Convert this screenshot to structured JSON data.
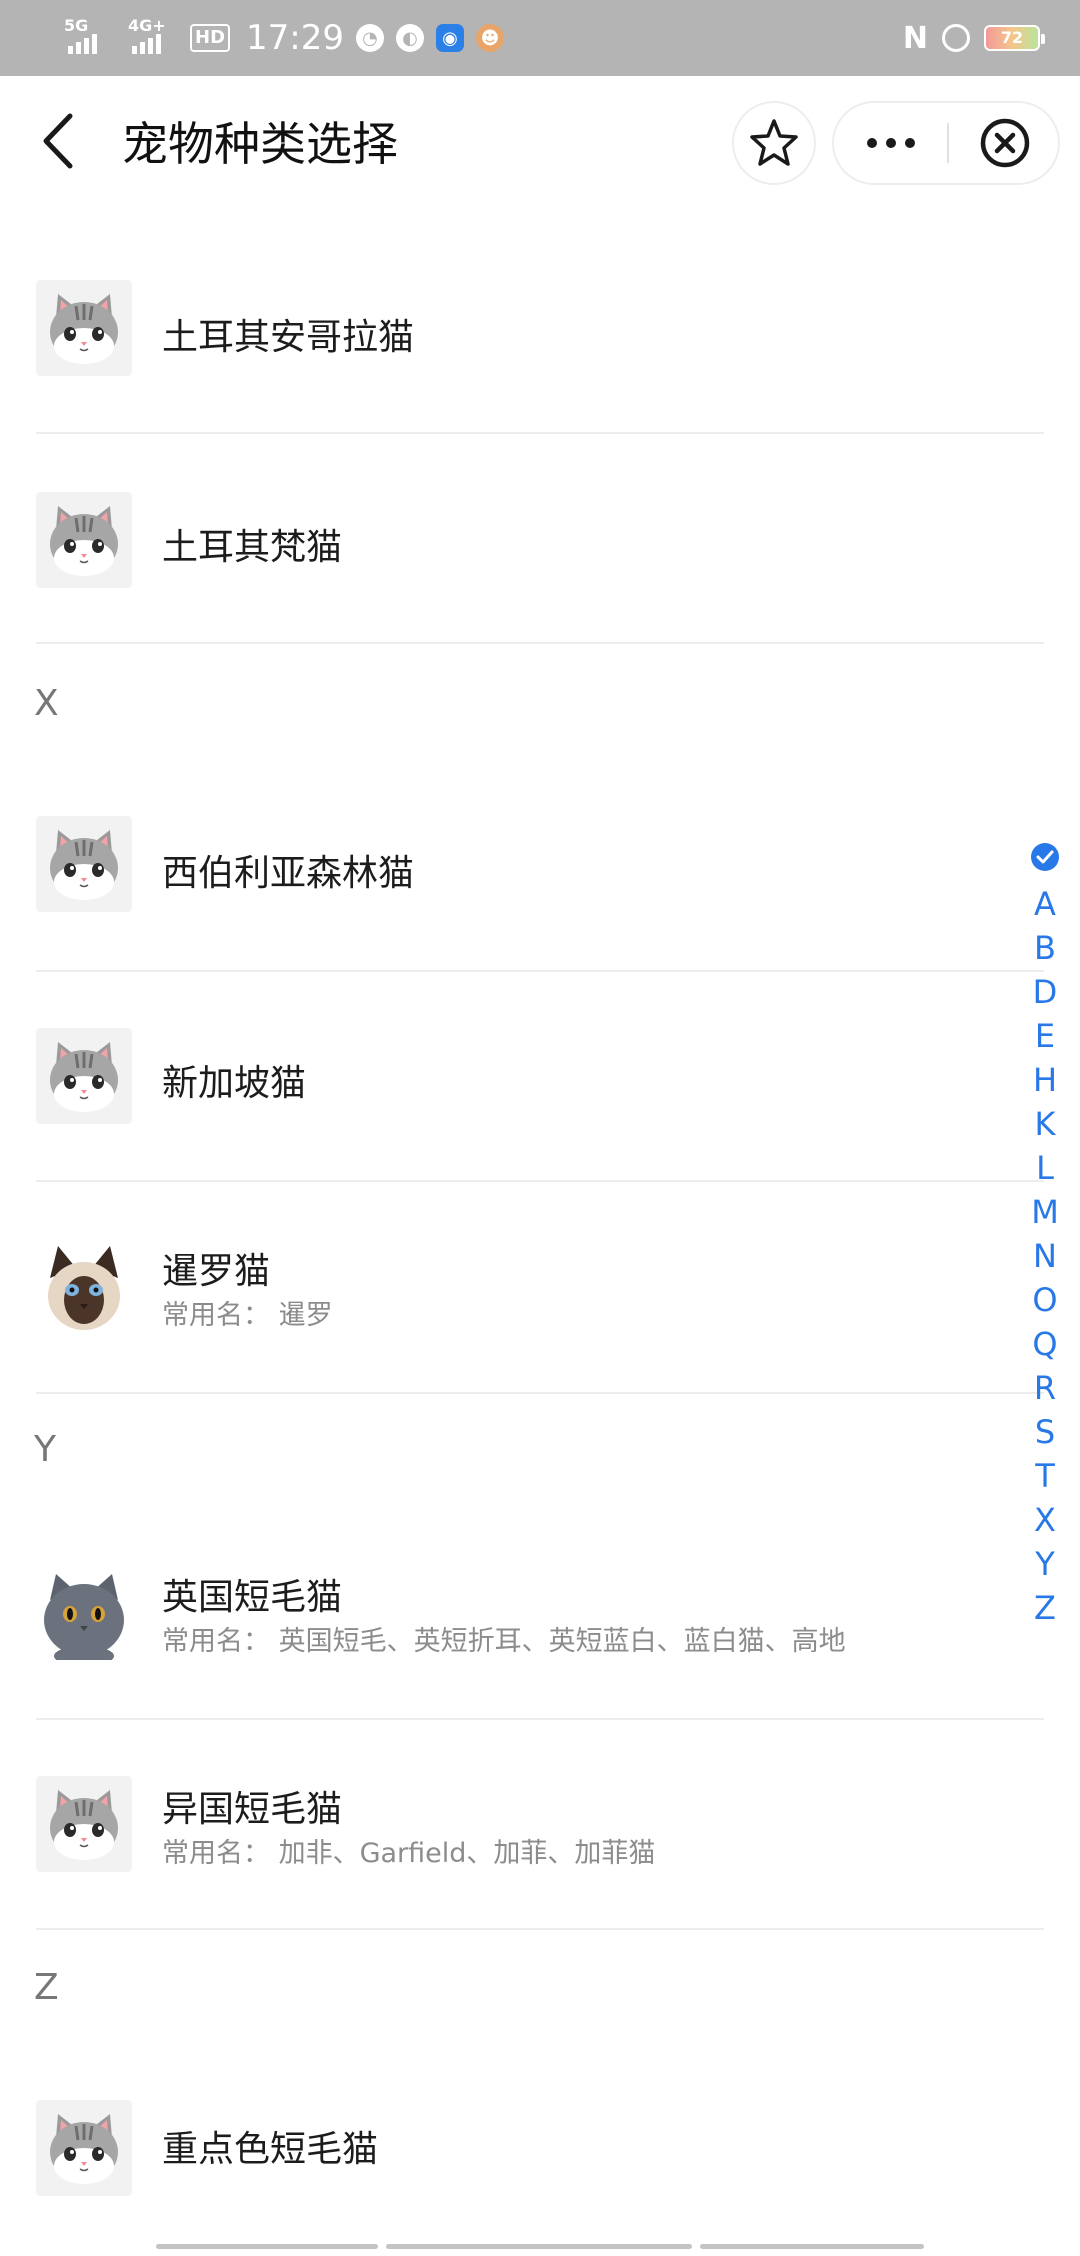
{
  "status_bar": {
    "net1": "5G",
    "net2": "4G+",
    "hd": "HD",
    "time": "17:29",
    "nfc": "N",
    "battery": "72"
  },
  "header": {
    "title": "宠物种类选择"
  },
  "list": {
    "alias_label": "常用名：",
    "items": [
      {
        "name": "土耳其安哥拉猫",
        "image": "cartoon-cat-icon"
      },
      {
        "name": "土耳其梵猫",
        "image": "cartoon-cat-icon"
      },
      {
        "section": "X"
      },
      {
        "name": "西伯利亚森林猫",
        "image": "cartoon-cat-icon"
      },
      {
        "name": "新加坡猫",
        "image": "cartoon-cat-icon"
      },
      {
        "name": "暹罗猫",
        "alias": "暹罗",
        "image": "siamese-cat-photo"
      },
      {
        "section": "Y"
      },
      {
        "name": "英国短毛猫",
        "alias": "英国短毛、英短折耳、英短蓝白、蓝白猫、高地",
        "image": "british-shorthair-photo"
      },
      {
        "name": "异国短毛猫",
        "alias": "加非、Garfield、加菲、加菲猫",
        "image": "cartoon-cat-icon"
      },
      {
        "section": "Z"
      },
      {
        "name": "重点色短毛猫",
        "image": "cartoon-cat-icon"
      }
    ]
  },
  "index_bar": {
    "active": "check",
    "letters": [
      "A",
      "B",
      "D",
      "E",
      "H",
      "K",
      "L",
      "M",
      "N",
      "O",
      "Q",
      "R",
      "S",
      "T",
      "X",
      "Y",
      "Z"
    ]
  },
  "colors": {
    "accent": "#2878e8",
    "status_bar_bg": "#b4b4b4"
  }
}
